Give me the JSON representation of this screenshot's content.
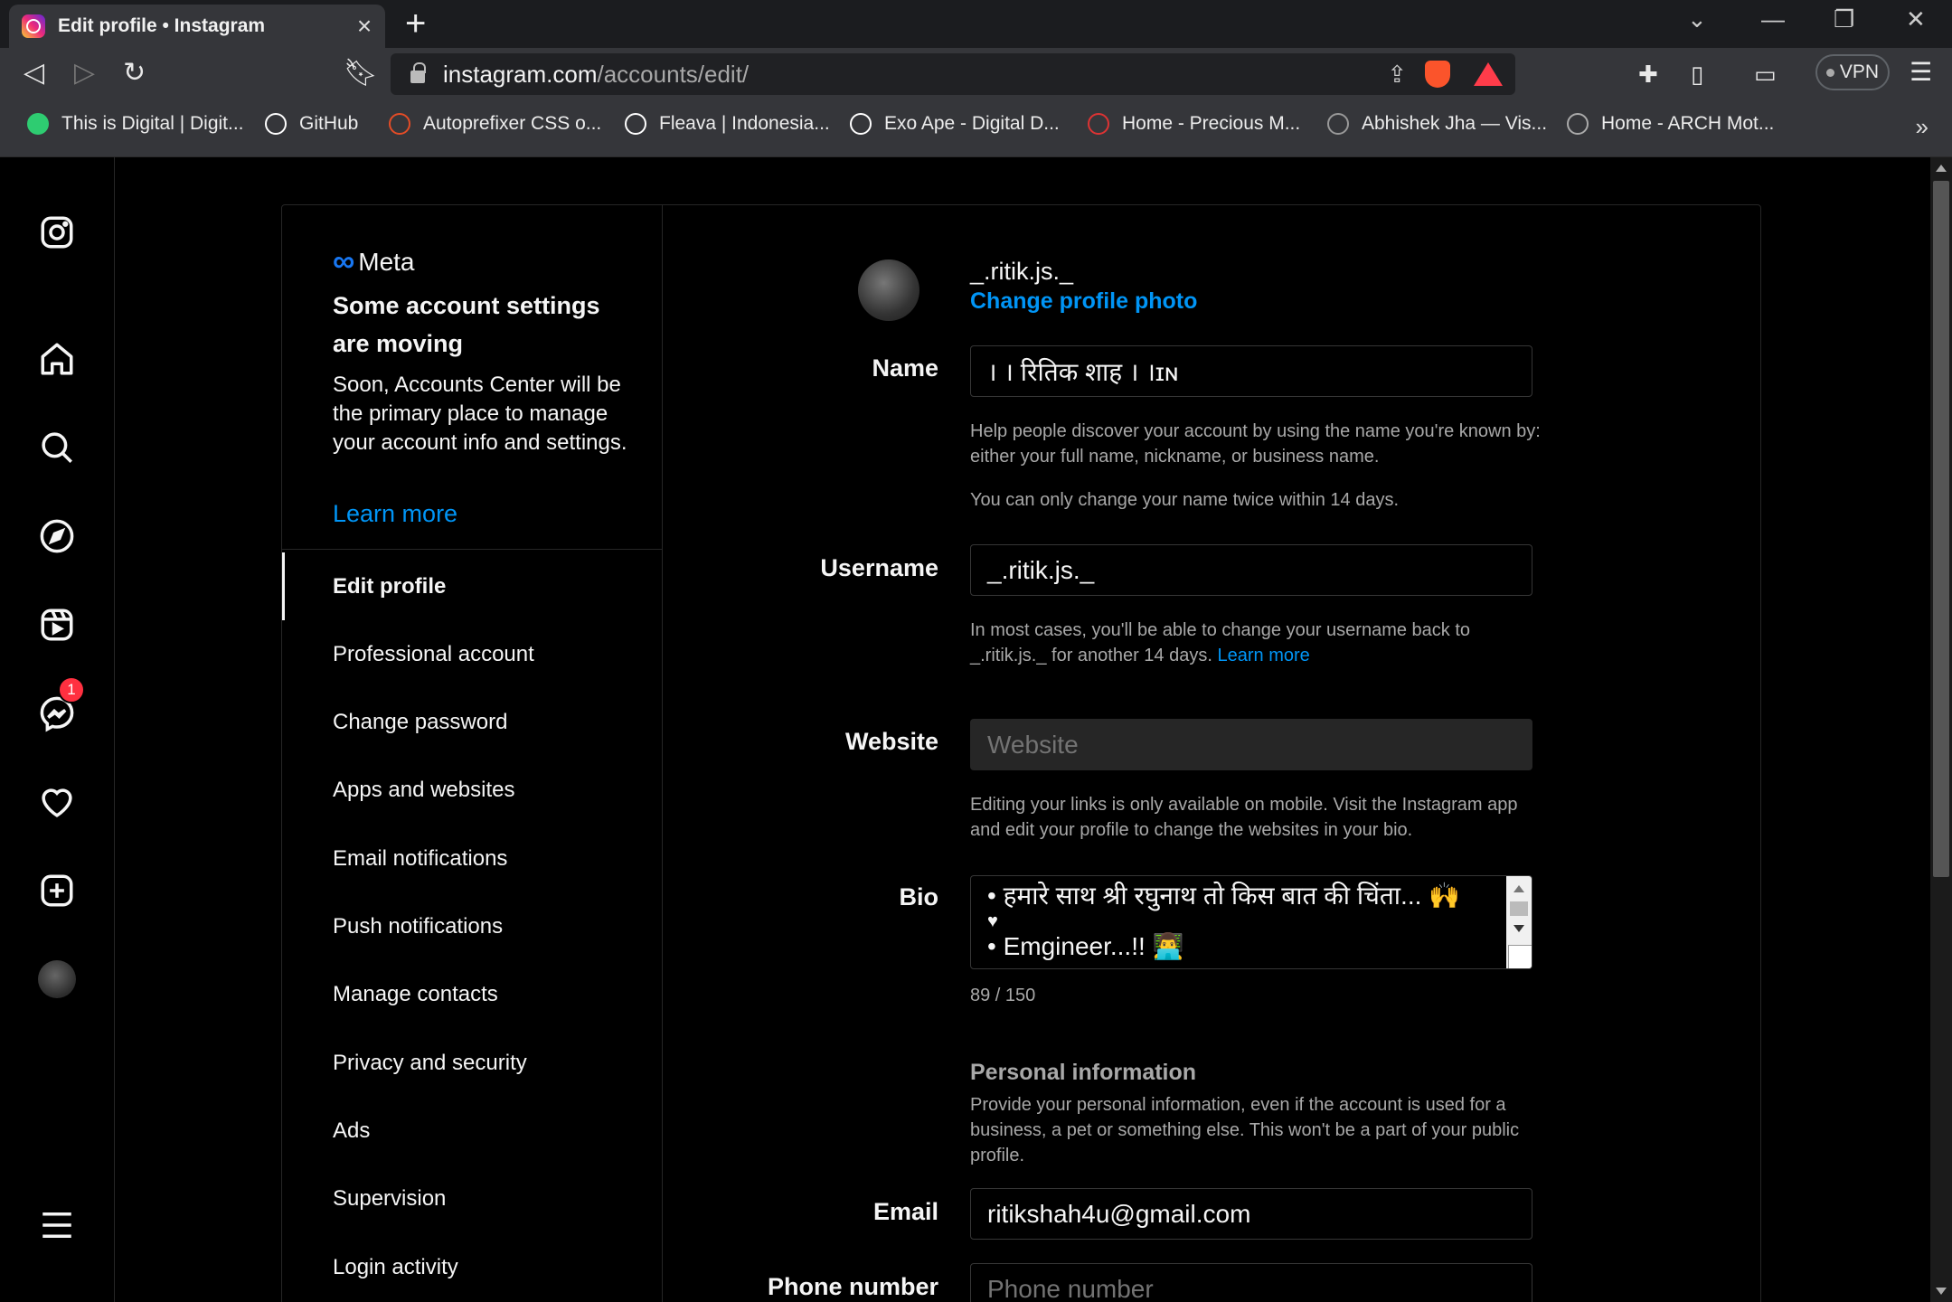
{
  "browser": {
    "tab_title": "Edit profile • Instagram",
    "url_host": "instagram.com",
    "url_path": "/accounts/edit/",
    "vpn_label": "VPN",
    "bookmarks": [
      {
        "label": "This is Digital | Digit...",
        "icon": "green-dot-icon",
        "color": "#2ecc71"
      },
      {
        "label": "GitHub",
        "icon": "github-icon",
        "color": "#ffffff"
      },
      {
        "label": "Autoprefixer CSS o...",
        "icon": "autoprefixer-icon",
        "color": "#e34c26"
      },
      {
        "label": "Fleava | Indonesia...",
        "icon": "fleava-icon",
        "color": "#ffffff"
      },
      {
        "label": "Exo Ape - Digital D...",
        "icon": "exoape-icon",
        "color": "#ffffff"
      },
      {
        "label": "Home - Precious M...",
        "icon": "precious-icon",
        "color": "#d33"
      },
      {
        "label": "Abhishek Jha — Vis...",
        "icon": "abhishek-icon",
        "color": "#999999"
      },
      {
        "label": "Home - ARCH Mot...",
        "icon": "arch-icon",
        "color": "#aaaaaa"
      }
    ]
  },
  "rail": {
    "messages_badge": "1"
  },
  "sidebar": {
    "meta_label": "Meta",
    "moving_title": "Some account settings are moving",
    "moving_body": "Soon, Accounts Center will be the primary place to manage your account info and settings.",
    "learn_more": "Learn more",
    "items": [
      {
        "label": "Edit profile",
        "active": true
      },
      {
        "label": "Professional account"
      },
      {
        "label": "Change password"
      },
      {
        "label": "Apps and websites"
      },
      {
        "label": "Email notifications"
      },
      {
        "label": "Push notifications"
      },
      {
        "label": "Manage contacts"
      },
      {
        "label": "Privacy and security"
      },
      {
        "label": "Ads"
      },
      {
        "label": "Supervision"
      },
      {
        "label": "Login activity"
      }
    ]
  },
  "profile": {
    "username": "_.ritik.js._",
    "change_photo": "Change profile photo"
  },
  "form": {
    "name_label": "Name",
    "name_value": "। । रितिक शाह । ।ɪɴ",
    "name_help_1": "Help people discover your account by using the name you're known by: either your full name, nickname, or business name.",
    "name_help_2": "You can only change your name twice within 14 days.",
    "username_label": "Username",
    "username_value": "_.ritik.js._",
    "username_help": "In most cases, you'll be able to change your username back to _.ritik.js._ for another 14 days.",
    "username_help_link": "Learn more",
    "website_label": "Website",
    "website_placeholder": "Website",
    "website_help": "Editing your links is only available on mobile. Visit the Instagram app and edit your profile to change the websites in your bio.",
    "bio_label": "Bio",
    "bio_line_1": "• हमारे साथ श्री रघुनाथ तो किस बात की चिंता... 🙌",
    "bio_line_2": "♥",
    "bio_line_3": "• Emgineer...!! 👨‍💻",
    "bio_counter": "89 / 150",
    "personal_title": "Personal information",
    "personal_help": "Provide your personal information, even if the account is used for a business, a pet or something else. This won't be a part of your public profile.",
    "email_label": "Email",
    "email_value": "ritikshah4u@gmail.com",
    "phone_label": "Phone number",
    "phone_placeholder": "Phone number"
  }
}
